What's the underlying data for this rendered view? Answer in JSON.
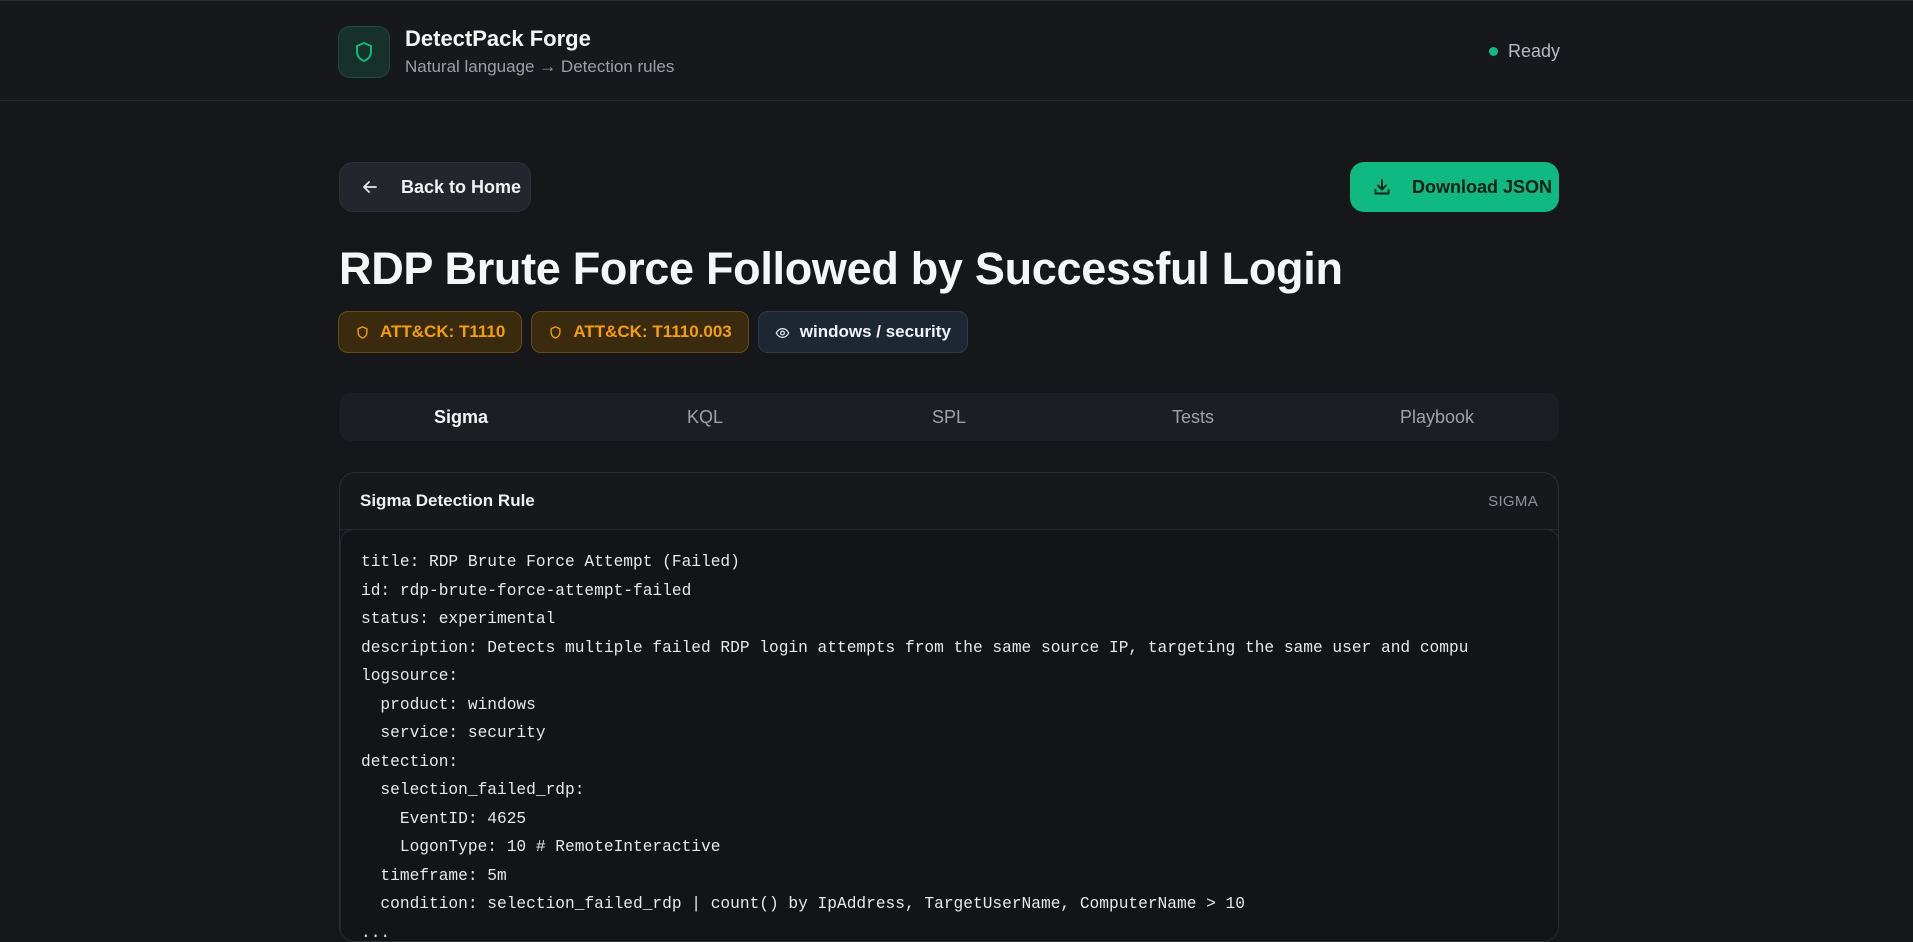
{
  "header": {
    "app_name": "DetectPack Forge",
    "subtitle": "Natural language → Detection rules",
    "status": "Ready",
    "logo_icon": "shield-icon"
  },
  "actions": {
    "back_label": "Back to Home",
    "download_label": "Download JSON"
  },
  "rule": {
    "title": "RDP Brute Force Followed by Successful Login",
    "badges": [
      {
        "label": "ATT&CK: T1110",
        "icon": "shield-icon"
      },
      {
        "label": "ATT&CK: T1110.003",
        "icon": "shield-icon"
      },
      {
        "label": "windows / security",
        "icon": "eye-icon"
      }
    ]
  },
  "tabs": [
    {
      "label": "Sigma",
      "active": true
    },
    {
      "label": "KQL",
      "active": false
    },
    {
      "label": "SPL",
      "active": false
    },
    {
      "label": "Tests",
      "active": false
    },
    {
      "label": "Playbook",
      "active": false
    }
  ],
  "panel": {
    "title": "Sigma Detection Rule",
    "tag": "SIGMA",
    "code_lines": [
      "title: RDP Brute Force Attempt (Failed)",
      "id: rdp-brute-force-attempt-failed",
      "status: experimental",
      "description: Detects multiple failed RDP login attempts from the same source IP, targeting the same user and compu",
      "logsource:",
      "  product: windows",
      "  service: security",
      "detection:",
      "  selection_failed_rdp:",
      "    EventID: 4625",
      "    LogonType: 10 # RemoteInteractive",
      "  timeframe: 5m",
      "  condition: selection_failed_rdp | count() by IpAddress, TargetUserName, ComputerName > 10",
      "..."
    ]
  },
  "colors": {
    "accent": "#10b981",
    "attack_badge": "#f59e0b",
    "background": "#15171b"
  }
}
